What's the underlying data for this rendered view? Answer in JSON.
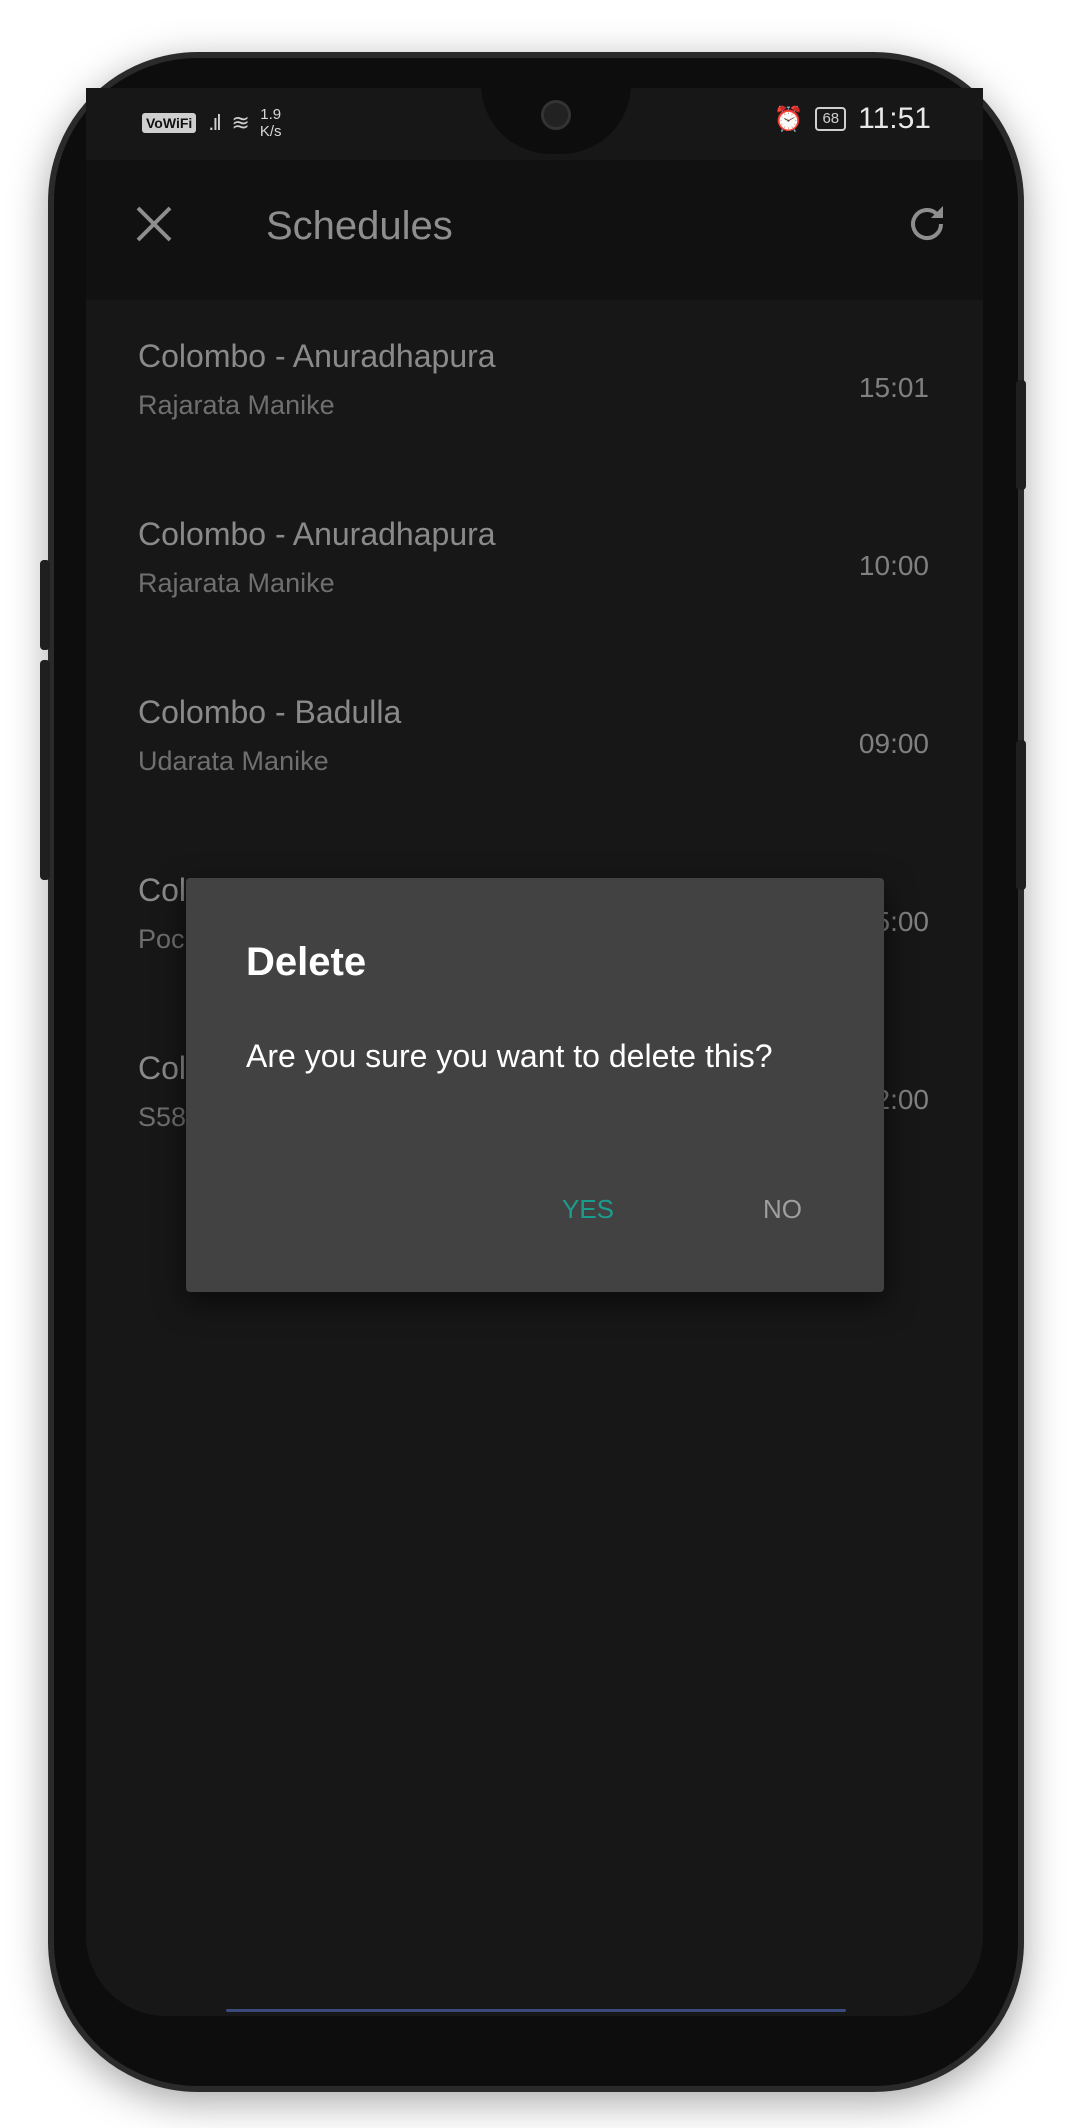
{
  "statusbar": {
    "vowifi": "VoWiFi",
    "signal": ".ıl",
    "wifi": "≋",
    "speed_value": "1.9",
    "speed_unit": "K/s",
    "battery": "68",
    "time": "11:51"
  },
  "appbar": {
    "title": "Schedules"
  },
  "schedules": [
    {
      "route": "Colombo - Anuradhapura",
      "train": "Rajarata Manike",
      "time": "15:01"
    },
    {
      "route": "Colombo - Anuradhapura",
      "train": "Rajarata Manike",
      "time": "10:00"
    },
    {
      "route": "Colombo - Badulla",
      "train": "Udarata Manike",
      "time": "09:00"
    },
    {
      "route": "Col",
      "train": "Poc",
      "time": "5:00"
    },
    {
      "route": "Col",
      "train": "S58",
      "time": "2:00"
    }
  ],
  "dialog": {
    "title": "Delete",
    "message": "Are you sure you want to delete this?",
    "yes_label": "YES",
    "no_label": "NO"
  }
}
